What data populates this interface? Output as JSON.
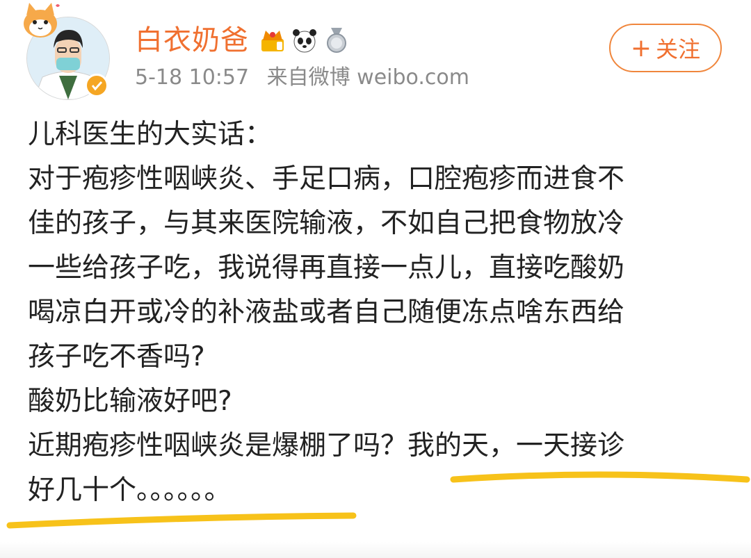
{
  "post": {
    "username": "白衣奶爸",
    "timestamp": "5-18 10:57",
    "source": "来自微博 weibo.com",
    "follow_plus": "+",
    "follow_label": "关注",
    "badges": [
      "crown-badge-icon",
      "panda-badge-icon",
      "medal-badge-icon"
    ],
    "text_lines": [
      "儿科医生的大实话：",
      "对于疱疹性咽峡炎、手足口病，口腔疱疹而进食不",
      "佳的孩子，与其来医院输液，不如自己把食物放冷",
      "一些给孩子吃，我说得再直接一点儿，直接吃酸奶",
      "喝凉白开或冷的补液盐或者自己随便冻点啥东西给",
      "孩子吃不香吗?",
      "酸奶比输液好吧?",
      "近期疱疹性咽峡炎是爆棚了吗？我的天，一天接诊",
      "好几十个。。。。。。"
    ]
  },
  "colors": {
    "username": "#f07030",
    "follow_border": "#f0863c",
    "meta": "#8a8a8a",
    "highlight": "#f7c21a",
    "verified": "#f5a623"
  }
}
